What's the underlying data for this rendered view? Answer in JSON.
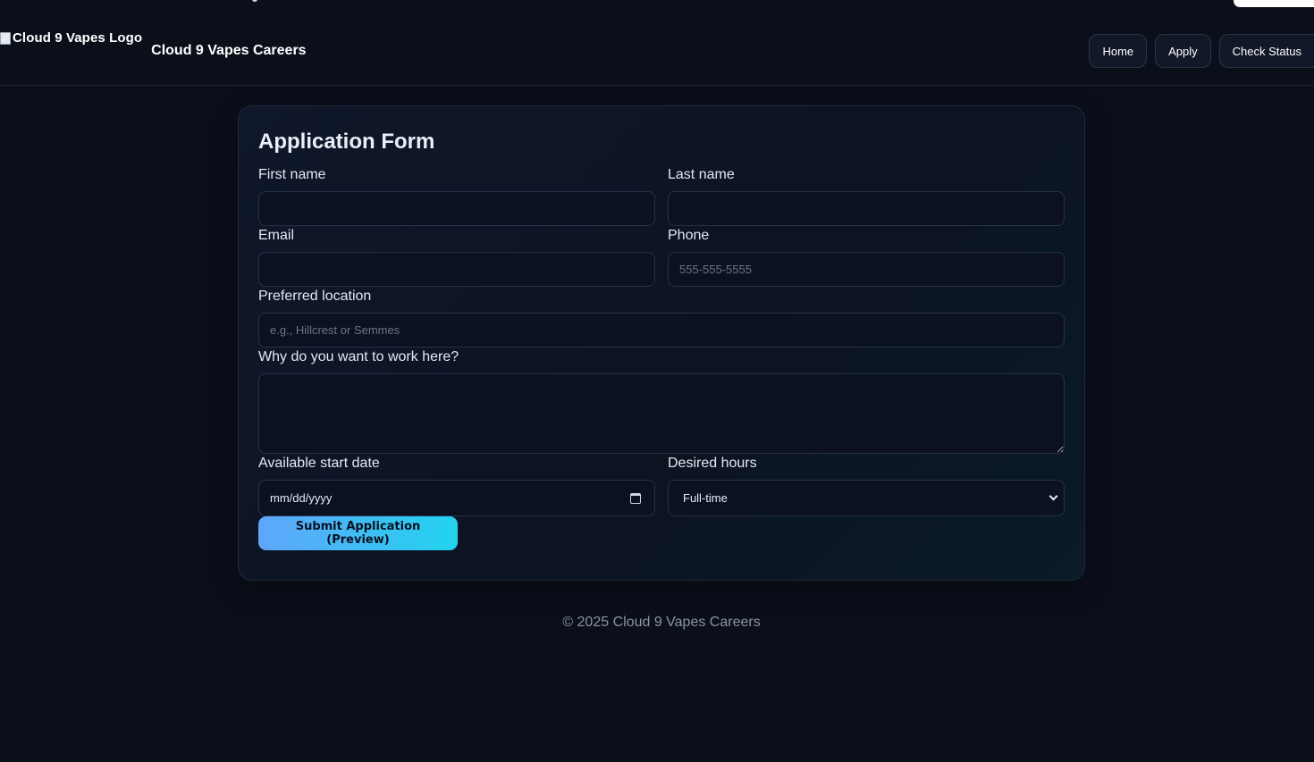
{
  "header": {
    "logo_alt": "Cloud 9 Vapes Logo",
    "site_title": "Cloud 9 Vapes Careers",
    "nav": [
      {
        "label": "Home"
      },
      {
        "label": "Apply"
      },
      {
        "label": "Check Status"
      }
    ]
  },
  "form": {
    "title": "Application Form",
    "first_name": {
      "label": "First name",
      "value": "",
      "placeholder": ""
    },
    "last_name": {
      "label": "Last name",
      "value": "",
      "placeholder": ""
    },
    "email": {
      "label": "Email",
      "value": "",
      "placeholder": ""
    },
    "phone": {
      "label": "Phone",
      "value": "",
      "placeholder": "555-555-5555"
    },
    "location": {
      "label": "Preferred location",
      "value": "",
      "placeholder": "e.g., Hillcrest or Semmes"
    },
    "why": {
      "label": "Why do you want to work here?",
      "value": ""
    },
    "start_date": {
      "label": "Available start date",
      "display": "mm/dd/yyyy"
    },
    "hours": {
      "label": "Desired hours",
      "selected": "Full-time"
    },
    "submit_label": "Submit Application (Preview)"
  },
  "footer": {
    "text": "© 2025 Cloud 9 Vapes Careers"
  },
  "colors": {
    "background": "#0b0f1a",
    "card": "#0f172a",
    "accent_start": "#60a5fa",
    "accent_end": "#22d3ee"
  }
}
